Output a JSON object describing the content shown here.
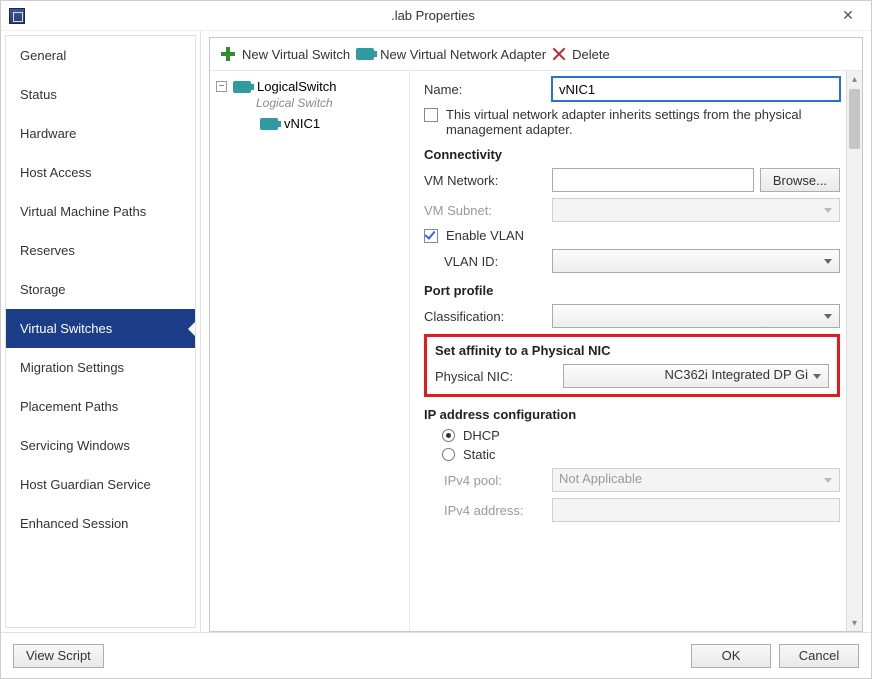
{
  "window": {
    "title": ".lab Properties"
  },
  "sidebar": {
    "items": [
      {
        "label": "General"
      },
      {
        "label": "Status"
      },
      {
        "label": "Hardware"
      },
      {
        "label": "Host Access"
      },
      {
        "label": "Virtual Machine Paths"
      },
      {
        "label": "Reserves"
      },
      {
        "label": "Storage"
      },
      {
        "label": "Virtual Switches"
      },
      {
        "label": "Migration Settings"
      },
      {
        "label": "Placement Paths"
      },
      {
        "label": "Servicing Windows"
      },
      {
        "label": "Host Guardian Service"
      },
      {
        "label": "Enhanced Session"
      }
    ],
    "selected_index": 7
  },
  "toolbar": {
    "new_switch": "New Virtual Switch",
    "new_adapter": "New Virtual Network Adapter",
    "delete": "Delete"
  },
  "tree": {
    "switch_name": "LogicalSwitch",
    "switch_subtitle": "Logical Switch",
    "adapter_name": "vNIC1"
  },
  "form": {
    "name_label": "Name:",
    "name_value": "vNIC1",
    "inherit_label": "This virtual network adapter inherits settings from the physical management adapter.",
    "connectivity_h": "Connectivity",
    "vm_network_label": "VM Network:",
    "vm_network_value": "",
    "browse_btn": "Browse...",
    "vm_subnet_label": "VM Subnet:",
    "enable_vlan_label": "Enable VLAN",
    "vlan_id_label": "VLAN ID:",
    "port_profile_h": "Port profile",
    "classification_label": "Classification:",
    "affinity_h": "Set affinity to a Physical NIC",
    "physical_nic_label": "Physical NIC:",
    "physical_nic_value": "NC362i Integrated DP Gi",
    "ip_h": "IP address configuration",
    "dhcp_label": "DHCP",
    "static_label": "Static",
    "ipv4_pool_label": "IPv4 pool:",
    "ipv4_pool_value": "Not Applicable",
    "ipv4_addr_label": "IPv4 address:"
  },
  "footer": {
    "view_script": "View Script",
    "ok": "OK",
    "cancel": "Cancel"
  }
}
